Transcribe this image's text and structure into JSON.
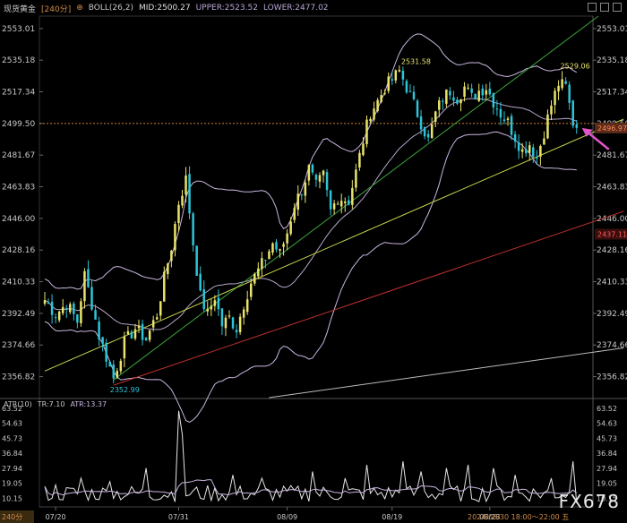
{
  "header": {
    "symbol": "现货黄金",
    "period": "[240分]",
    "indicator": "BOLL(26,2)",
    "mid": "MID:2500.27",
    "upper": "UPPER:2523.52",
    "lower": "LOWER:2477.02"
  },
  "atr_header": {
    "label": "ATR(10)",
    "tr": "TR:7.10",
    "atr": "ATR:13.37"
  },
  "watermark": "FX678",
  "footnote": "2024/08/30 18:00～22:00 五",
  "period_badge": "240分",
  "colors": {
    "up": "#e8e36a",
    "down": "#2ec4d6",
    "band": "#c9b6e0",
    "green_line": "#3fa33f",
    "yellow_line": "#c9d64a",
    "red_line": "#c03030",
    "white_line": "#bbbbbb",
    "dashed": "#d4803a",
    "arrow": "#e056c8"
  },
  "chart_data": [
    {
      "type": "candlestick",
      "ylim": [
        2345,
        2560
      ],
      "y_ticks": [
        2553.01,
        2535.18,
        2517.34,
        2499.5,
        2481.67,
        2463.83,
        2446.0,
        2428.16,
        2410.33,
        2392.49,
        2374.66,
        2356.82
      ],
      "x_ticks": [
        "07/20",
        "07/31",
        "08/09",
        "08/19",
        "08/28"
      ],
      "x_tick_index": [
        3,
        37,
        67,
        96,
        123
      ],
      "last_price": 2496.97,
      "secondary_label": 2437.11,
      "reference_level": 2499.5,
      "annotations": [
        {
          "text": "2352.99",
          "index": 19,
          "value": 2352.99
        },
        {
          "text": "2531.58",
          "index": 99,
          "value": 2531.58
        },
        {
          "text": "2529.06",
          "index": 143,
          "value": 2529.06
        }
      ],
      "channel_lines": [
        {
          "name": "",
          "points": [
            [
              19,
              2355
            ],
            [
              153,
              2560
            ]
          ]
        },
        {
          "name": "",
          "points": [
            [
              0,
              2360
            ],
            [
              160,
              2502
            ]
          ]
        },
        {
          "name": "",
          "points": [
            [
              19,
              2352
            ],
            [
              160,
              2450
            ]
          ]
        },
        {
          "name": "",
          "points": [
            [
              62,
              2345
            ],
            [
              160,
              2373
            ]
          ]
        }
      ],
      "anchors": [
        [
          0,
          2400
        ],
        [
          3,
          2392
        ],
        [
          6,
          2398
        ],
        [
          9,
          2388
        ],
        [
          11,
          2414
        ],
        [
          13,
          2398
        ],
        [
          15,
          2380
        ],
        [
          17,
          2368
        ],
        [
          19,
          2356
        ],
        [
          22,
          2376
        ],
        [
          25,
          2384
        ],
        [
          28,
          2378
        ],
        [
          31,
          2392
        ],
        [
          33,
          2412
        ],
        [
          35,
          2430
        ],
        [
          37,
          2455
        ],
        [
          39,
          2468
        ],
        [
          41,
          2432
        ],
        [
          43,
          2402
        ],
        [
          45,
          2392
        ],
        [
          47,
          2402
        ],
        [
          49,
          2386
        ],
        [
          51,
          2390
        ],
        [
          53,
          2384
        ],
        [
          55,
          2398
        ],
        [
          57,
          2410
        ],
        [
          60,
          2420
        ],
        [
          63,
          2432
        ],
        [
          65,
          2426
        ],
        [
          67,
          2438
        ],
        [
          69,
          2454
        ],
        [
          71,
          2462
        ],
        [
          73,
          2474
        ],
        [
          75,
          2464
        ],
        [
          77,
          2470
        ],
        [
          79,
          2450
        ],
        [
          81,
          2458
        ],
        [
          84,
          2456
        ],
        [
          86,
          2472
        ],
        [
          88,
          2490
        ],
        [
          90,
          2506
        ],
        [
          92,
          2512
        ],
        [
          94,
          2520
        ],
        [
          96,
          2524
        ],
        [
          98,
          2529
        ],
        [
          100,
          2520
        ],
        [
          102,
          2510
        ],
        [
          104,
          2500
        ],
        [
          106,
          2490
        ],
        [
          108,
          2505
        ],
        [
          110,
          2514
        ],
        [
          112,
          2518
        ],
        [
          114,
          2514
        ],
        [
          116,
          2520
        ],
        [
          118,
          2514
        ],
        [
          120,
          2518
        ],
        [
          122,
          2520
        ],
        [
          124,
          2512
        ],
        [
          126,
          2505
        ],
        [
          128,
          2500
        ],
        [
          130,
          2492
        ],
        [
          132,
          2484
        ],
        [
          134,
          2488
        ],
        [
          136,
          2480
        ],
        [
          138,
          2495
        ],
        [
          140,
          2510
        ],
        [
          142,
          2522
        ],
        [
          144,
          2520
        ],
        [
          146,
          2500
        ],
        [
          147,
          2497
        ]
      ]
    },
    {
      "type": "line",
      "title": "ATR(10)",
      "ylim": [
        5,
        64
      ],
      "y_ticks": [
        63.52,
        54.63,
        45.73,
        36.84,
        27.94,
        19.05,
        10.15
      ],
      "series": [
        {
          "name": "TR",
          "last": 7.1
        },
        {
          "name": "ATR",
          "last": 13.37
        }
      ],
      "spikes": [
        [
          37,
          62
        ],
        [
          38,
          48
        ],
        [
          28,
          28
        ],
        [
          52,
          24
        ],
        [
          60,
          22
        ],
        [
          74,
          26
        ],
        [
          83,
          22
        ],
        [
          89,
          30
        ],
        [
          99,
          32
        ],
        [
          104,
          26
        ],
        [
          111,
          28
        ],
        [
          117,
          30
        ],
        [
          124,
          28
        ],
        [
          130,
          24
        ],
        [
          140,
          22
        ],
        [
          146,
          32
        ],
        [
          150,
          22
        ],
        [
          10,
          22
        ],
        [
          18,
          20
        ],
        [
          3,
          18
        ]
      ]
    }
  ]
}
